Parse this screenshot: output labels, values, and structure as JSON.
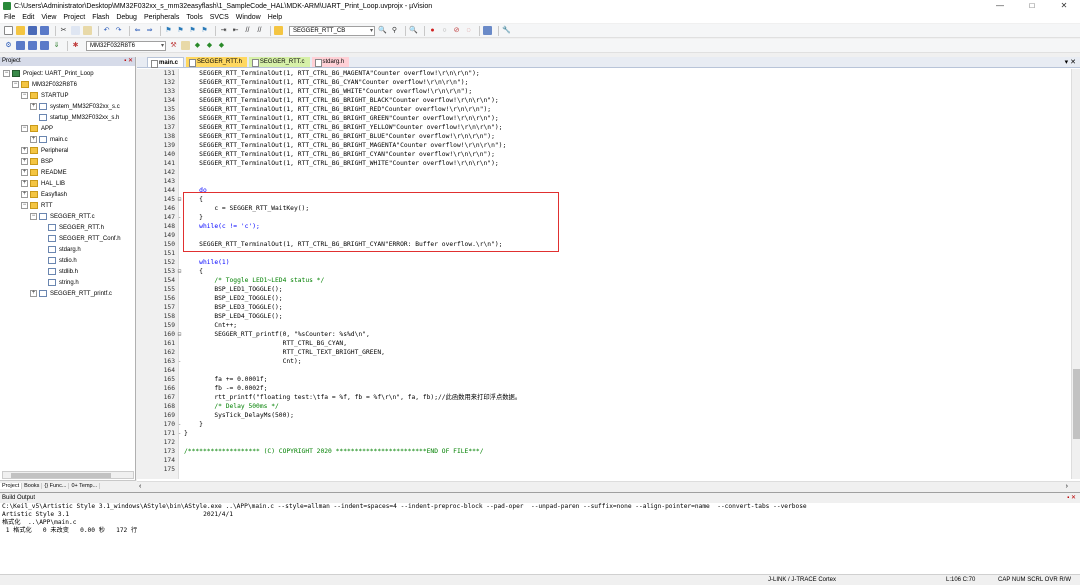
{
  "window": {
    "title": "C:\\Users\\Administrator\\Desktop\\MM32F032xx_s_mm32easyflash\\1_SampleCode_HAL\\MDK-ARM\\UART_Print_Loop.uvprojx - µVision",
    "min": "—",
    "max": "□",
    "close": "✕"
  },
  "menu": [
    "File",
    "Edit",
    "View",
    "Project",
    "Flash",
    "Debug",
    "Peripherals",
    "Tools",
    "SVCS",
    "Window",
    "Help"
  ],
  "toolbar": {
    "find_combo": "SEGGER_RTT_CB",
    "target_combo": "MM32F032R8T6"
  },
  "project_panel": {
    "title": "Project",
    "tree": [
      {
        "label": "Project: UART_Print_Loop",
        "icon": "proj"
      },
      {
        "label": "MM32F032R8T6",
        "icon": "folder"
      },
      {
        "label": "STARTUP",
        "icon": "folder"
      },
      {
        "label": "system_MM32F032xx_s.c",
        "icon": "file"
      },
      {
        "label": "startup_MM32F032xx_s.h",
        "icon": "file"
      },
      {
        "label": "APP",
        "icon": "folder"
      },
      {
        "label": "main.c",
        "icon": "file"
      },
      {
        "label": "Peripheral",
        "icon": "folder"
      },
      {
        "label": "BSP",
        "icon": "folder"
      },
      {
        "label": "README",
        "icon": "folder"
      },
      {
        "label": "HAL_LIB",
        "icon": "folder"
      },
      {
        "label": "Easyflash",
        "icon": "folder"
      },
      {
        "label": "RTT",
        "icon": "folder"
      },
      {
        "label": "SEGGER_RTT.c",
        "icon": "file"
      },
      {
        "label": "SEGGER_RTT.h",
        "icon": "file"
      },
      {
        "label": "SEGGER_RTT_Conf.h",
        "icon": "file"
      },
      {
        "label": "stdarg.h",
        "icon": "file"
      },
      {
        "label": "stdio.h",
        "icon": "file"
      },
      {
        "label": "stdlib.h",
        "icon": "file"
      },
      {
        "label": "string.h",
        "icon": "file"
      },
      {
        "label": "SEGGER_RTT_printf.c",
        "icon": "file"
      }
    ],
    "tabs": [
      "Project",
      "Books",
      "{} Func...",
      "0+ Temp..."
    ]
  },
  "editor": {
    "tabs": [
      "main.c",
      "SEGGER_RTT.h",
      "SEGGER_RTT.c",
      "stdarg.h"
    ],
    "lines": [
      {
        "n": "131",
        "f": "",
        "t": "    SEGGER_RTT_TerminalOut(1, RTT_CTRL_BG_MAGENTA\"Counter overflow!\\r\\n\\r\\n\");"
      },
      {
        "n": "132",
        "f": "",
        "t": "    SEGGER_RTT_TerminalOut(1, RTT_CTRL_BG_CYAN\"Counter overflow!\\r\\n\\r\\n\");"
      },
      {
        "n": "133",
        "f": "",
        "t": "    SEGGER_RTT_TerminalOut(1, RTT_CTRL_BG_WHITE\"Counter overflow!\\r\\n\\r\\n\");"
      },
      {
        "n": "134",
        "f": "",
        "t": "    SEGGER_RTT_TerminalOut(1, RTT_CTRL_BG_BRIGHT_BLACK\"Counter overflow!\\r\\n\\r\\n\");"
      },
      {
        "n": "135",
        "f": "",
        "t": "    SEGGER_RTT_TerminalOut(1, RTT_CTRL_BG_BRIGHT_RED\"Counter overflow!\\r\\n\\r\\n\");"
      },
      {
        "n": "136",
        "f": "",
        "t": "    SEGGER_RTT_TerminalOut(1, RTT_CTRL_BG_BRIGHT_GREEN\"Counter overflow!\\r\\n\\r\\n\");"
      },
      {
        "n": "137",
        "f": "",
        "t": "    SEGGER_RTT_TerminalOut(1, RTT_CTRL_BG_BRIGHT_YELLOW\"Counter overflow!\\r\\n\\r\\n\");"
      },
      {
        "n": "138",
        "f": "",
        "t": "    SEGGER_RTT_TerminalOut(1, RTT_CTRL_BG_BRIGHT_BLUE\"Counter overflow!\\r\\n\\r\\n\");"
      },
      {
        "n": "139",
        "f": "",
        "t": "    SEGGER_RTT_TerminalOut(1, RTT_CTRL_BG_BRIGHT_MAGENTA\"Counter overflow!\\r\\n\\r\\n\");"
      },
      {
        "n": "140",
        "f": "",
        "t": "    SEGGER_RTT_TerminalOut(1, RTT_CTRL_BG_BRIGHT_CYAN\"Counter overflow!\\r\\n\\r\\n\");"
      },
      {
        "n": "141",
        "f": "",
        "t": "    SEGGER_RTT_TerminalOut(1, RTT_CTRL_BG_BRIGHT_WHITE\"Counter overflow!\\r\\n\\r\\n\");"
      },
      {
        "n": "142",
        "f": "",
        "t": ""
      },
      {
        "n": "143",
        "f": "",
        "t": ""
      },
      {
        "n": "144",
        "f": "",
        "t": "    do"
      },
      {
        "n": "145",
        "f": "⊟",
        "t": "    {"
      },
      {
        "n": "146",
        "f": "",
        "t": "        c = SEGGER_RTT_WaitKey();"
      },
      {
        "n": "147",
        "f": "-",
        "t": "    }"
      },
      {
        "n": "148",
        "f": "",
        "t": "    while(c != 'c');"
      },
      {
        "n": "149",
        "f": "",
        "t": ""
      },
      {
        "n": "150",
        "f": "",
        "t": "    SEGGER_RTT_TerminalOut(1, RTT_CTRL_BG_BRIGHT_CYAN\"ERROR: Buffer overflow.\\r\\n\");"
      },
      {
        "n": "151",
        "f": "",
        "t": ""
      },
      {
        "n": "152",
        "f": "",
        "t": "    while(1)"
      },
      {
        "n": "153",
        "f": "⊟",
        "t": "    {"
      },
      {
        "n": "154",
        "f": "",
        "t": "        /* Toggle LED1~LED4 status */"
      },
      {
        "n": "155",
        "f": "",
        "t": "        BSP_LED1_TOGGLE();"
      },
      {
        "n": "156",
        "f": "",
        "t": "        BSP_LED2_TOGGLE();"
      },
      {
        "n": "157",
        "f": "",
        "t": "        BSP_LED3_TOGGLE();"
      },
      {
        "n": "158",
        "f": "",
        "t": "        BSP_LED4_TOGGLE();"
      },
      {
        "n": "159",
        "f": "",
        "t": "        Cnt++;"
      },
      {
        "n": "160",
        "f": "⊟",
        "t": "        SEGGER_RTT_printf(0, \"%sCounter: %s%d\\n\","
      },
      {
        "n": "161",
        "f": "",
        "t": "                          RTT_CTRL_BG_CYAN,"
      },
      {
        "n": "162",
        "f": "",
        "t": "                          RTT_CTRL_TEXT_BRIGHT_GREEN,"
      },
      {
        "n": "163",
        "f": "-",
        "t": "                          Cnt);"
      },
      {
        "n": "164",
        "f": "",
        "t": ""
      },
      {
        "n": "165",
        "f": "",
        "t": "        fa += 0.0001f;"
      },
      {
        "n": "166",
        "f": "",
        "t": "        fb -= 0.0002f;"
      },
      {
        "n": "167",
        "f": "",
        "t": "        rtt_printf(\"floating test:\\tfa = %f, fb = %f\\r\\n\", fa, fb);//此函数用来打印浮点数据。"
      },
      {
        "n": "168",
        "f": "",
        "t": "        /* Delay 500ms */"
      },
      {
        "n": "169",
        "f": "",
        "t": "        SysTick_DelayMs(500);"
      },
      {
        "n": "170",
        "f": "-",
        "t": "    }"
      },
      {
        "n": "171",
        "f": "-",
        "t": "}"
      },
      {
        "n": "172",
        "f": "",
        "t": ""
      },
      {
        "n": "173",
        "f": "",
        "t": "/******************* (C) COPYRIGHT 2020 ************************END OF FILE***/"
      },
      {
        "n": "174",
        "f": "",
        "t": ""
      },
      {
        "n": "175",
        "f": "",
        "t": ""
      }
    ]
  },
  "build_output": {
    "title": "Build Output",
    "lines": [
      "C:\\Keil_v5\\Artistic Style 3.1_windows\\AStyle\\bin\\AStyle.exe ..\\APP\\main.c --style=allman --indent=spaces=4 --indent-preproc-block --pad-oper  --unpad-paren --suffix=none --align-pointer=name  --convert-tabs --verbose",
      "Artistic Style 3.1                                    2021/4/1",
      "格式化  ..\\APP\\main.c",
      " 1 格式化   0 未改变   0.00 秒   172 行"
    ]
  },
  "status": {
    "debugger": "J-LINK / J-TRACE Cortex",
    "position": "L:106 C:70",
    "flags": "CAP NUM SCRL OVR R/W"
  }
}
